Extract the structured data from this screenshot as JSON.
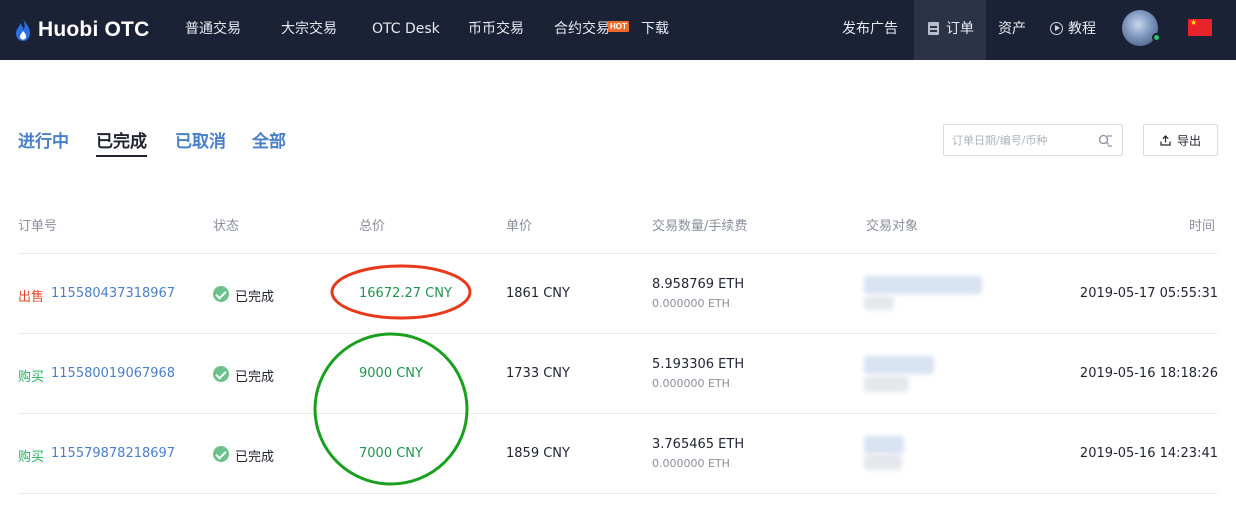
{
  "header": {
    "logo_text": "Huobi OTC",
    "nav": [
      {
        "label": "普通交易"
      },
      {
        "label": "大宗交易"
      },
      {
        "label": "OTC Desk"
      },
      {
        "label": "币币交易"
      },
      {
        "label": "合约交易",
        "badge": "HOT"
      },
      {
        "label": "下载"
      }
    ],
    "right_nav": {
      "post_ad": "发布广告",
      "orders": "订单",
      "assets": "资产",
      "tutorial": "教程"
    }
  },
  "tabs": [
    {
      "label": "进行中",
      "active": false
    },
    {
      "label": "已完成",
      "active": true
    },
    {
      "label": "已取消",
      "active": false
    },
    {
      "label": "全部",
      "active": false
    }
  ],
  "search": {
    "placeholder": "订单日期/编号/币种"
  },
  "export_label": "导出",
  "table": {
    "headers": {
      "order_no": "订单号",
      "status": "状态",
      "total": "总价",
      "unit_price": "单价",
      "quantity_fee": "交易数量/手续费",
      "counterparty": "交易对象",
      "time": "时间"
    },
    "rows": [
      {
        "side": "出售",
        "side_type": "sell",
        "order_id": "115580437318967",
        "status": "已完成",
        "total": "16672.27 CNY",
        "price": "1861 CNY",
        "amount": "8.958769 ETH",
        "fee": "0.000000 ETH",
        "time": "2019-05-17 05:55:31"
      },
      {
        "side": "购买",
        "side_type": "buy",
        "order_id": "115580019067968",
        "status": "已完成",
        "total": "9000 CNY",
        "price": "1733 CNY",
        "amount": "5.193306 ETH",
        "fee": "0.000000 ETH",
        "time": "2019-05-16 18:18:26"
      },
      {
        "side": "购买",
        "side_type": "buy",
        "order_id": "115579878218697",
        "status": "已完成",
        "total": "7000 CNY",
        "price": "1859 CNY",
        "amount": "3.765465 ETH",
        "fee": "0.000000 ETH",
        "time": "2019-05-16 14:23:41"
      }
    ]
  },
  "colors": {
    "nav_bg": "#1c2235",
    "link_blue": "#4a7fc8",
    "sell_red": "#e2482e",
    "buy_green": "#22b05a",
    "total_green": "#22924f",
    "annotation_red": "#e8391c",
    "annotation_green": "#1aa01f"
  },
  "icons": [
    "huobi-flame-icon",
    "hot-badge",
    "document-icon",
    "play-circle-icon",
    "avatar",
    "china-flag-icon",
    "search-list-icon",
    "export-icon",
    "check-circle-icon"
  ]
}
